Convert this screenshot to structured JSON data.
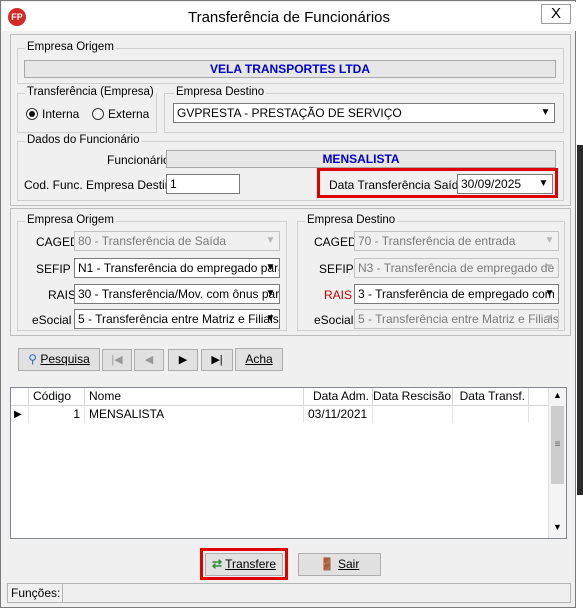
{
  "window": {
    "title": "Transferência de Funcionários",
    "close_glyph": "X",
    "app_icon_text": "FP"
  },
  "origin_company": {
    "legend": "Empresa Origem",
    "value": "VELA TRANSPORTES LTDA"
  },
  "transfer_type": {
    "legend": "Transferência (Empresa)",
    "options": [
      "Interna",
      "Externa"
    ],
    "selected": "Interna"
  },
  "dest_company": {
    "legend": "Empresa Destino",
    "selected": "GVPRESTA - PRESTAÇÃO DE SERVIÇO"
  },
  "employee": {
    "legend": "Dados do Funcionário",
    "funcionario_label": "Funcionário:",
    "funcionario_value": "MENSALISTA",
    "cod_label": "Cod. Func. Empresa Destino:",
    "cod_value": "1",
    "date_label": "Data Transferência Saída:",
    "date_value": "30/09/2025"
  },
  "codes": {
    "origin": {
      "legend": "Empresa Origem",
      "rows": [
        {
          "label": "CAGED",
          "value": "80 - Transferência de Saída",
          "enabled": false
        },
        {
          "label": "SEFIP",
          "value": "N1 - Transferência do empregado para",
          "enabled": true
        },
        {
          "label": "RAIS",
          "value": "30 - Transferência/Mov. com ônus par",
          "enabled": true
        },
        {
          "label": "eSocial",
          "value": "5 - Transferência entre Matriz e Filiais.",
          "enabled": true
        }
      ]
    },
    "dest": {
      "legend": "Empresa Destino",
      "rows": [
        {
          "label": "CAGED",
          "value": "70  -  Transferência de entrada",
          "enabled": false
        },
        {
          "label": "SEFIP",
          "value": "N3 - Transferência de empregado de o",
          "enabled": false
        },
        {
          "label": "RAIS",
          "value": "3 - Transferência de empregado com ô",
          "enabled": true
        },
        {
          "label": "eSocial",
          "value": "5 - Transferência entre Matriz e Filiais.",
          "enabled": false
        }
      ]
    },
    "accent_label_color": "#c00000"
  },
  "toolbar": {
    "pesquisa": "Pesquisa",
    "acha": "Acha",
    "nav": [
      "|◀",
      "◀",
      "▶",
      "▶|"
    ]
  },
  "grid": {
    "columns": [
      "Código",
      "Nome",
      "Data Adm.",
      "Data Rescisão",
      "Data Transf."
    ],
    "rows": [
      {
        "codigo": "1",
        "nome": "MENSALISTA",
        "data_adm": "03/11/2021",
        "data_rescisao": "",
        "data_transf": ""
      }
    ]
  },
  "actions": {
    "transfere": "Transfere",
    "sair": "Sair"
  },
  "status": {
    "label": "Funções:"
  },
  "colors": {
    "title_blue": "#0000cc",
    "highlight": "#e00000"
  }
}
